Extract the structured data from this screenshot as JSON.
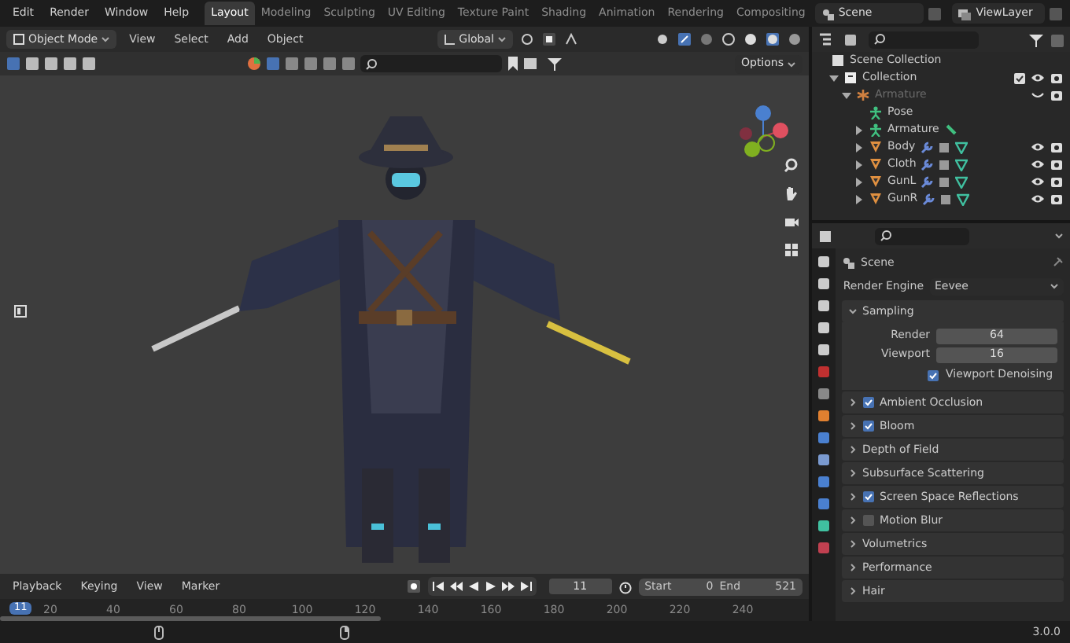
{
  "menu": [
    "Edit",
    "Render",
    "Window",
    "Help"
  ],
  "workspaces": [
    {
      "label": "Layout",
      "selected": true
    },
    {
      "label": "Modeling",
      "selected": false
    },
    {
      "label": "Sculpting",
      "selected": false
    },
    {
      "label": "UV Editing",
      "selected": false
    },
    {
      "label": "Texture Paint",
      "selected": false
    },
    {
      "label": "Shading",
      "selected": false
    },
    {
      "label": "Animation",
      "selected": false
    },
    {
      "label": "Rendering",
      "selected": false
    },
    {
      "label": "Compositing",
      "selected": false
    }
  ],
  "scene": "Scene",
  "view_layer": "ViewLayer",
  "viewport_header": {
    "mode": "Object Mode",
    "menus": [
      "View",
      "Select",
      "Add",
      "Object"
    ],
    "orientation": "Global",
    "options": "Options"
  },
  "outliner": {
    "items": [
      {
        "label": "Scene Collection",
        "kind": "scene",
        "disabled": false,
        "children": [
          {
            "label": "Collection",
            "kind": "collection",
            "disabled": false,
            "expanded": true,
            "visible": true,
            "children": [
              {
                "label": "Armature",
                "kind": "armature",
                "disabled": true,
                "expanded": true,
                "visible": false,
                "children": [
                  {
                    "label": "Pose",
                    "kind": "pose",
                    "disabled": false
                  },
                  {
                    "label": "Armature",
                    "kind": "armature_data",
                    "disabled": false,
                    "expanded": false
                  },
                  {
                    "label": "Body",
                    "kind": "mesh",
                    "disabled": false,
                    "expanded": false,
                    "visible": true
                  },
                  {
                    "label": "Cloth",
                    "kind": "mesh",
                    "disabled": false,
                    "expanded": false,
                    "visible": true
                  },
                  {
                    "label": "GunL",
                    "kind": "mesh",
                    "disabled": false,
                    "expanded": false,
                    "visible": true
                  },
                  {
                    "label": "GunR",
                    "kind": "mesh",
                    "disabled": false,
                    "expanded": false,
                    "visible": true
                  }
                ]
              }
            ]
          }
        ]
      }
    ]
  },
  "properties": {
    "context": "Scene",
    "render_engine_label": "Render Engine",
    "render_engine": "Eevee",
    "sampling": {
      "label": "Sampling",
      "expanded": true,
      "render_label": "Render",
      "render": "64",
      "viewport_label": "Viewport",
      "viewport": "16",
      "denoising": {
        "label": "Viewport Denoising",
        "checked": true
      }
    },
    "panels": [
      {
        "label": "Ambient Occlusion",
        "kind": "toggle",
        "checked": true
      },
      {
        "label": "Bloom",
        "kind": "toggle",
        "checked": true
      },
      {
        "label": "Depth of Field",
        "kind": "plain"
      },
      {
        "label": "Subsurface Scattering",
        "kind": "plain"
      },
      {
        "label": "Screen Space Reflections",
        "kind": "toggle",
        "checked": true
      },
      {
        "label": "Motion Blur",
        "kind": "toggle",
        "checked": false
      },
      {
        "label": "Volumetrics",
        "kind": "plain"
      },
      {
        "label": "Performance",
        "kind": "plain"
      },
      {
        "label": "Hair",
        "kind": "plain"
      }
    ]
  },
  "timeline": {
    "menus": [
      "Playback",
      "Keying",
      "View",
      "Marker"
    ],
    "current_frame": "11",
    "start_label": "Start",
    "start": "0",
    "end_label": "End",
    "end": "521",
    "playhead": "11",
    "ruler": [
      "20",
      "40",
      "60",
      "80",
      "100",
      "120",
      "140",
      "160",
      "180",
      "200",
      "220",
      "240"
    ]
  },
  "status_bar": {
    "version": "3.0.0"
  }
}
